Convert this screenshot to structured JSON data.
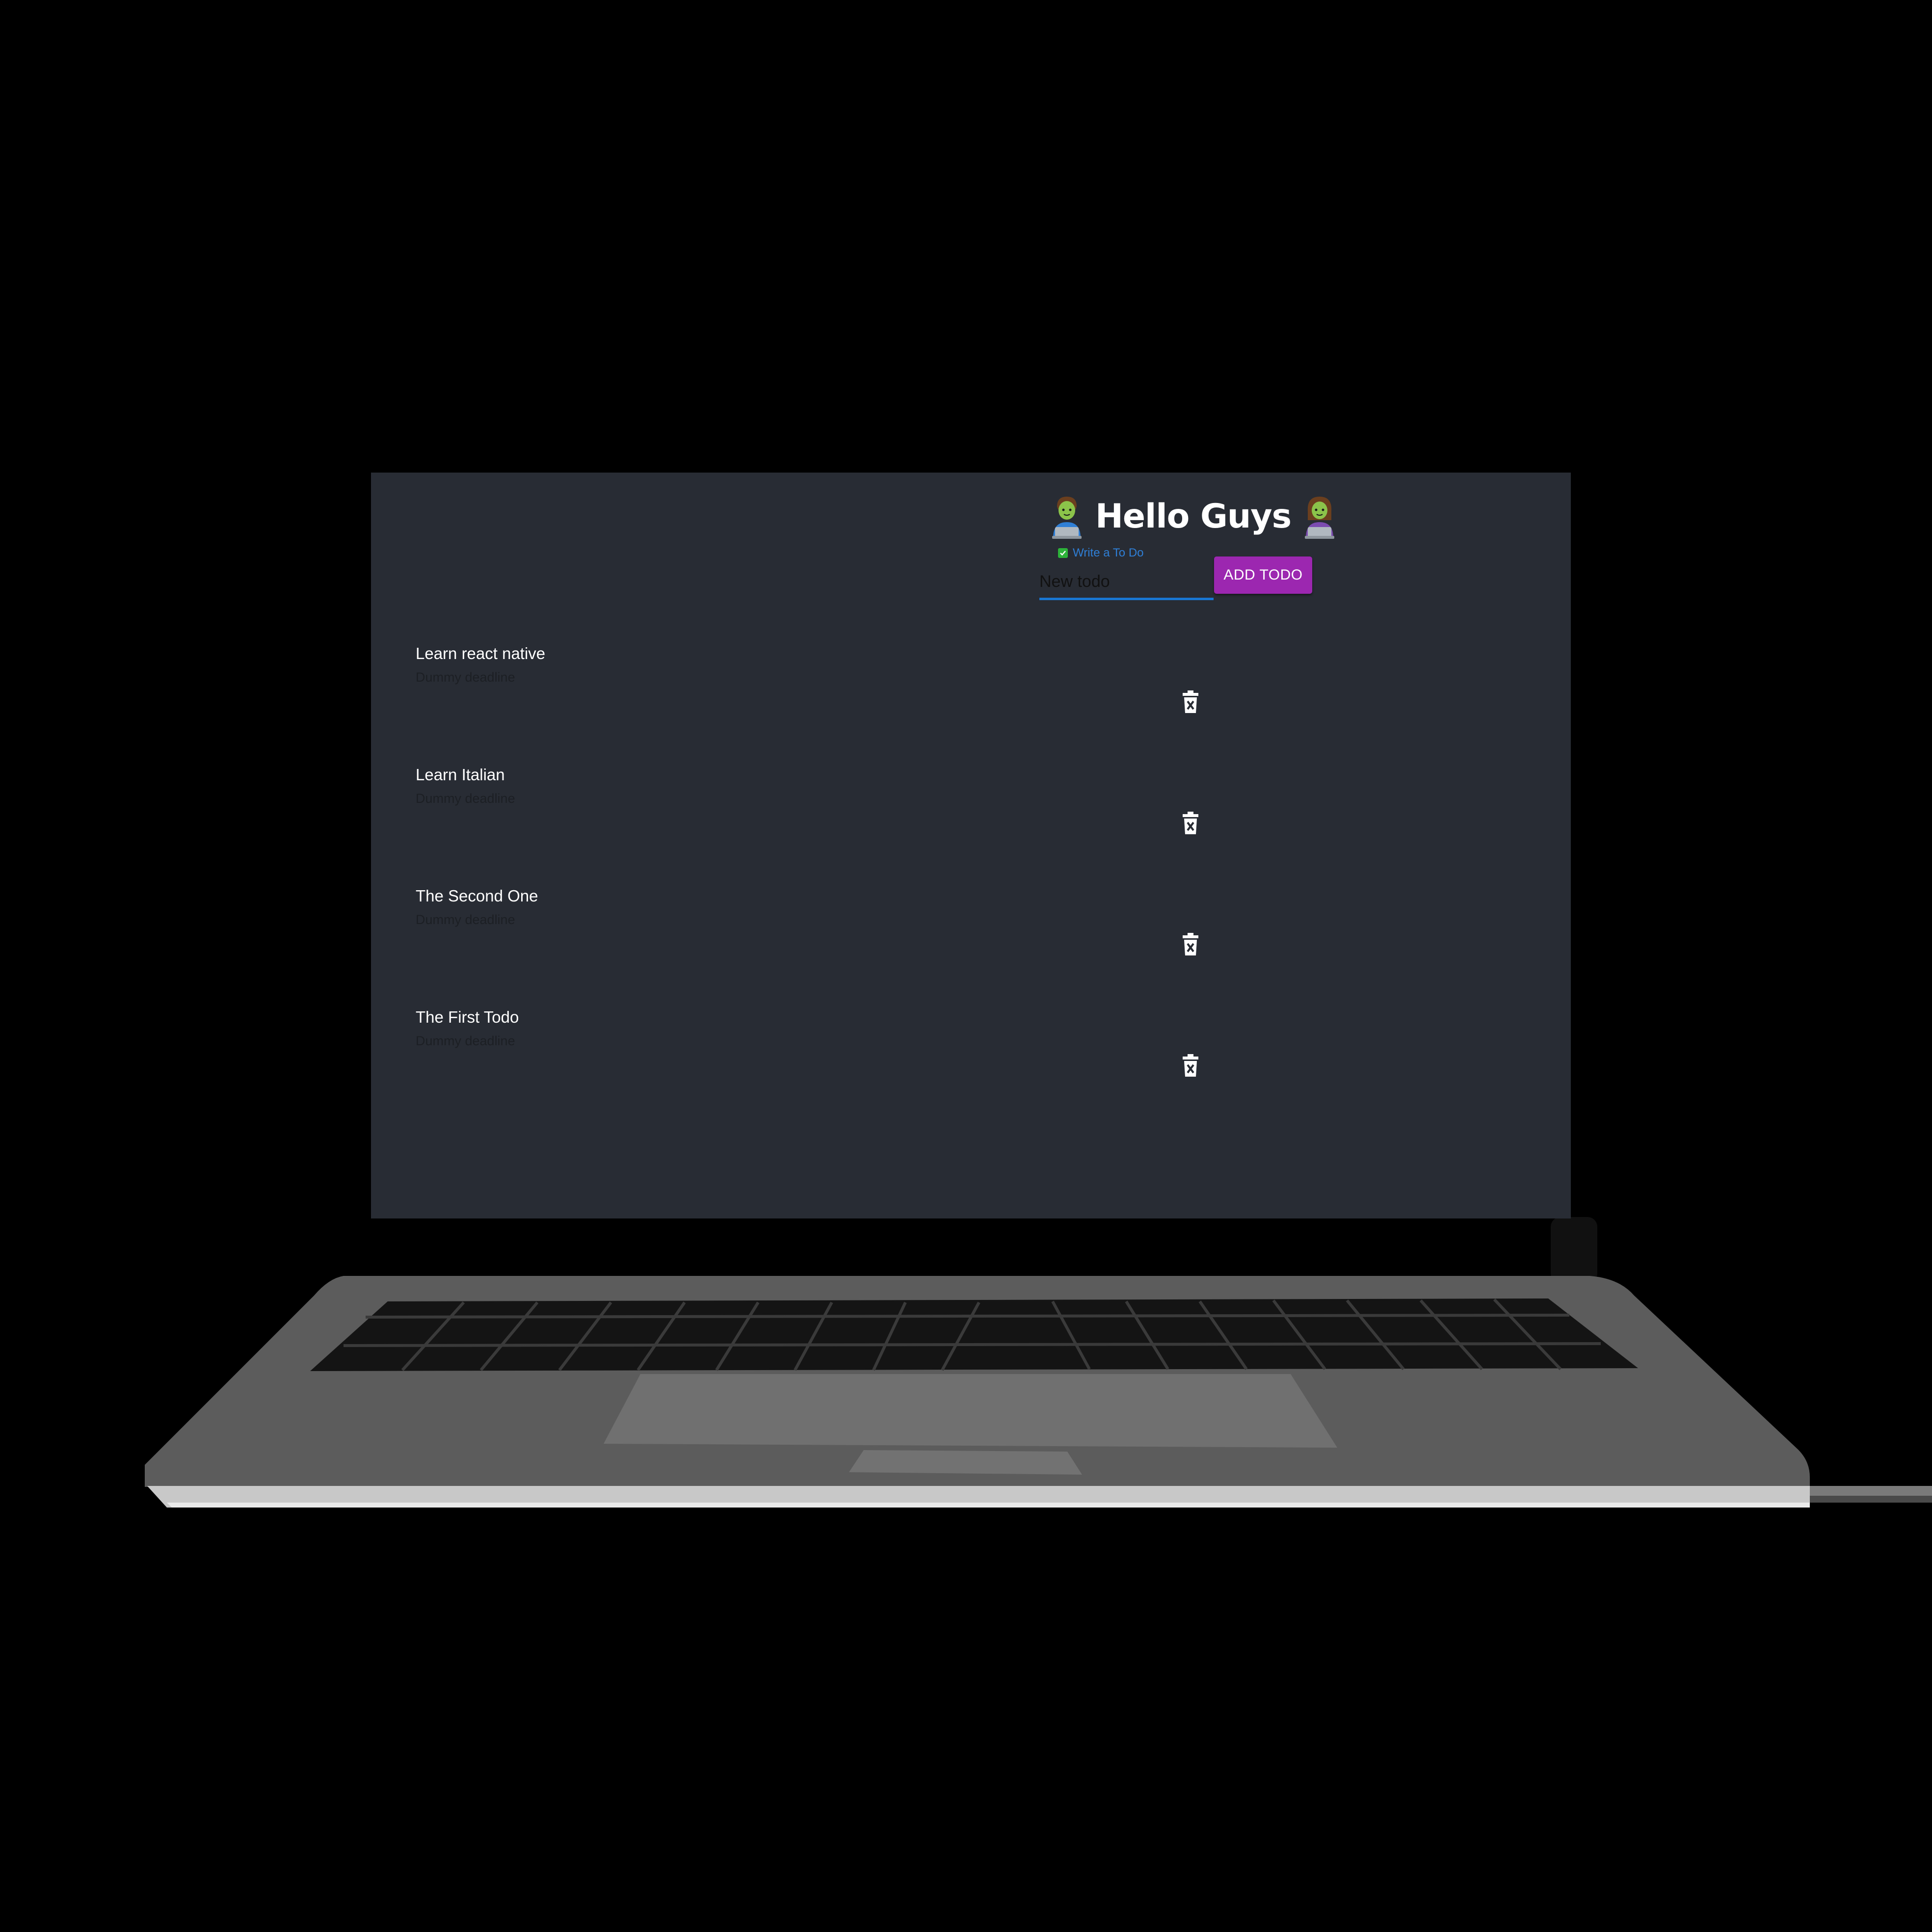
{
  "header": {
    "title": "Hello Guys",
    "left_emoji_icon": "man-technologist-icon",
    "right_emoji_icon": "woman-technologist-icon"
  },
  "form": {
    "hint_label": "Write a To Do",
    "input_value": "New todo",
    "add_button_label": "ADD TODO"
  },
  "todos": [
    {
      "title": "Learn react native",
      "deadline": "Dummy deadline",
      "delete_icon": "trash-icon"
    },
    {
      "title": "Learn Italian",
      "deadline": "Dummy deadline",
      "delete_icon": "trash-icon"
    },
    {
      "title": "The Second One",
      "deadline": "Dummy deadline",
      "delete_icon": "trash-icon"
    },
    {
      "title": "The First Todo",
      "deadline": "Dummy deadline",
      "delete_icon": "trash-icon"
    }
  ],
  "colors": {
    "screen_background": "#282c34",
    "accent_button": "#9c27b0",
    "input_underline": "#1976d2",
    "hint_text": "#2f7fd6",
    "checkbox": "#2db33a"
  }
}
